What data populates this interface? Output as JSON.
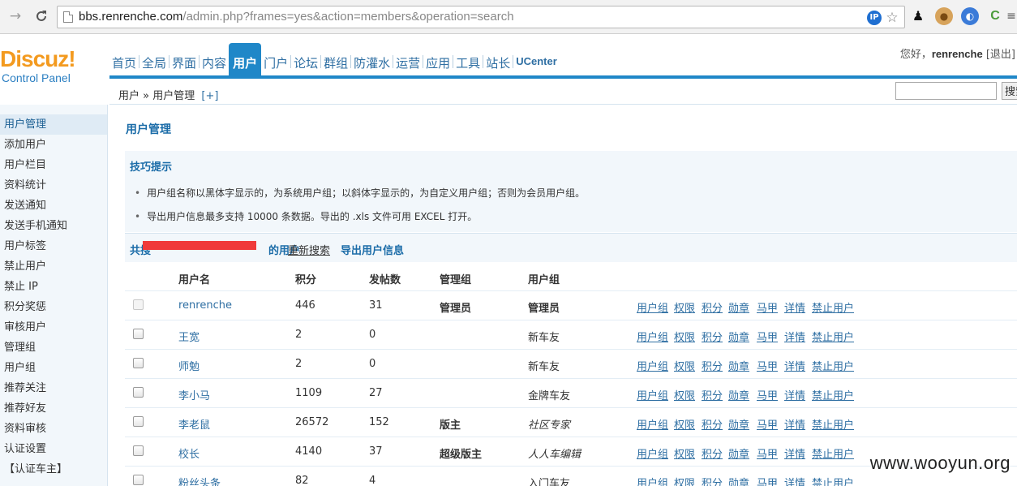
{
  "browser": {
    "url_host": "bbs.renrenche.com",
    "url_path": "/admin.php?frames=yes&action=members&operation=search"
  },
  "logo": {
    "name": "Discuz!",
    "subtitle": "Control Panel"
  },
  "topnav": {
    "items": [
      "首页",
      "全局",
      "界面",
      "内容",
      "用户",
      "门户",
      "论坛",
      "群组",
      "防灌水",
      "运营",
      "应用",
      "工具",
      "站长",
      "UCenter"
    ],
    "active": "用户"
  },
  "user": {
    "greeting": "您好，",
    "name": "renrenche",
    "logout": "[退出]"
  },
  "breadcrumb": {
    "parent": "用户",
    "sep": " » ",
    "current": "用户管理",
    "plus": "[+]"
  },
  "search": {
    "value": "",
    "button": "搜索"
  },
  "sidebar": {
    "items": [
      "用户管理",
      "添加用户",
      "用户栏目",
      "资料统计",
      "发送通知",
      "发送手机通知",
      "用户标签",
      "禁止用户",
      "禁止 IP",
      "积分奖惩",
      "审核用户",
      "管理组",
      "用户组",
      "推荐关注",
      "推荐好友",
      "资料审核",
      "认证设置",
      "【认证车主】"
    ],
    "active": "用户管理"
  },
  "page": {
    "title": "用户管理"
  },
  "tips": {
    "title": "技巧提示",
    "lines": [
      "用户组名称以黑体字显示的，为系统用户组；以斜体字显示的，为自定义用户组；否则为会员用户组。",
      "导出用户信息最多支持 10000 条数据。导出的 .xls 文件可用 EXCEL 打开。"
    ]
  },
  "result": {
    "prefix": "共搜",
    "suffix": "的用户",
    "research": "重新搜索",
    "export": "导出用户信息"
  },
  "table": {
    "headers": {
      "username": "用户名",
      "credits": "积分",
      "posts": "发帖数",
      "admingroup": "管理组",
      "usergroup": "用户组"
    },
    "actions": [
      "用户组",
      "权限",
      "积分",
      "勋章",
      "马甲",
      "详情",
      "禁止用户"
    ],
    "rows": [
      {
        "username": "renrenche",
        "credits": "446",
        "posts": "31",
        "admingroup": "管理员",
        "usergroup": "管理员",
        "usergroup_style": "bold",
        "disabled": true
      },
      {
        "username": "王宽",
        "credits": "2",
        "posts": "0",
        "admingroup": "",
        "usergroup": "新车友",
        "usergroup_style": "normal",
        "disabled": false
      },
      {
        "username": "师勉",
        "credits": "2",
        "posts": "0",
        "admingroup": "",
        "usergroup": "新车友",
        "usergroup_style": "normal",
        "disabled": false
      },
      {
        "username": "李小马",
        "credits": "1109",
        "posts": "27",
        "admingroup": "",
        "usergroup": "金牌车友",
        "usergroup_style": "normal",
        "disabled": false
      },
      {
        "username": "李老鼠",
        "credits": "26572",
        "posts": "152",
        "admingroup": "版主",
        "usergroup": "社区专家",
        "usergroup_style": "italic",
        "disabled": false
      },
      {
        "username": "校长",
        "credits": "4140",
        "posts": "37",
        "admingroup": "超级版主",
        "usergroup": "人人车编辑",
        "usergroup_style": "italic",
        "disabled": false
      },
      {
        "username": "粉丝头条",
        "credits": "82",
        "posts": "4",
        "admingroup": "",
        "usergroup": "入门车友",
        "usergroup_style": "normal",
        "disabled": false
      }
    ]
  },
  "watermark": "www.wooyun.org"
}
